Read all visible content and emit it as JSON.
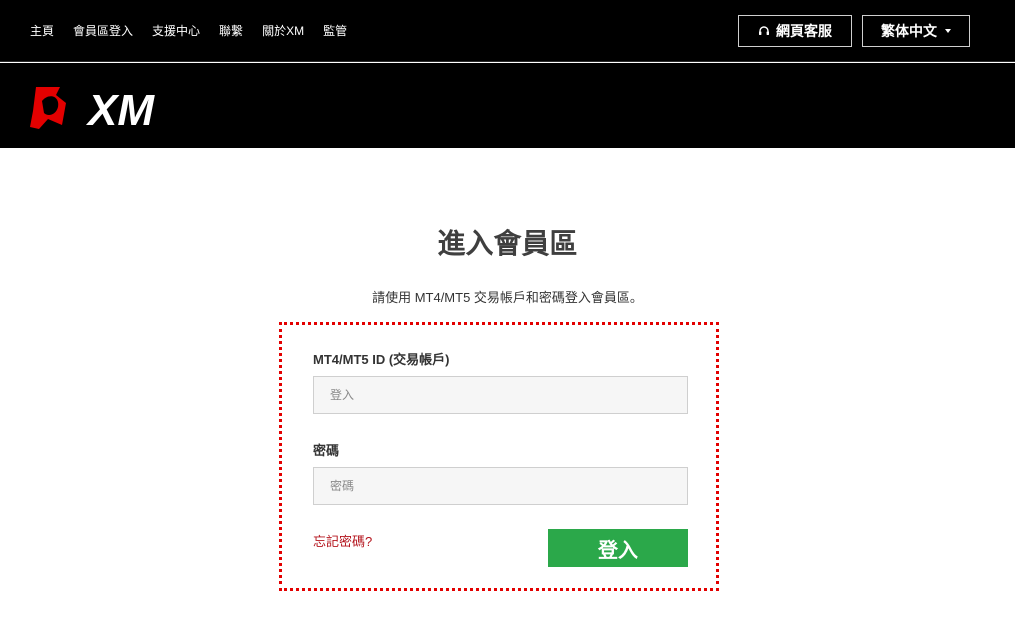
{
  "nav": {
    "items": [
      {
        "label": "主頁"
      },
      {
        "label": "會員區登入"
      },
      {
        "label": "支援中心"
      },
      {
        "label": "聯繫"
      },
      {
        "label": "關於XM"
      },
      {
        "label": "監管"
      }
    ]
  },
  "header": {
    "support_label": "網頁客服",
    "language_label": "繁体中文",
    "logo_text": "XM"
  },
  "main": {
    "title": "進入會員區",
    "subtitle": "請使用 MT4/MT5 交易帳戶和密碼登入會員區。"
  },
  "form": {
    "id_label": "MT4/MT5 ID (交易帳戶)",
    "id_placeholder": "登入",
    "password_label": "密碼",
    "password_placeholder": "密碼",
    "forgot_label": "忘記密碼?",
    "submit_label": "登入"
  },
  "colors": {
    "topbar_bg": "#000000",
    "accent_red": "#e30000",
    "submit_green": "#2ba84a",
    "forgot_red": "#b4141d"
  }
}
